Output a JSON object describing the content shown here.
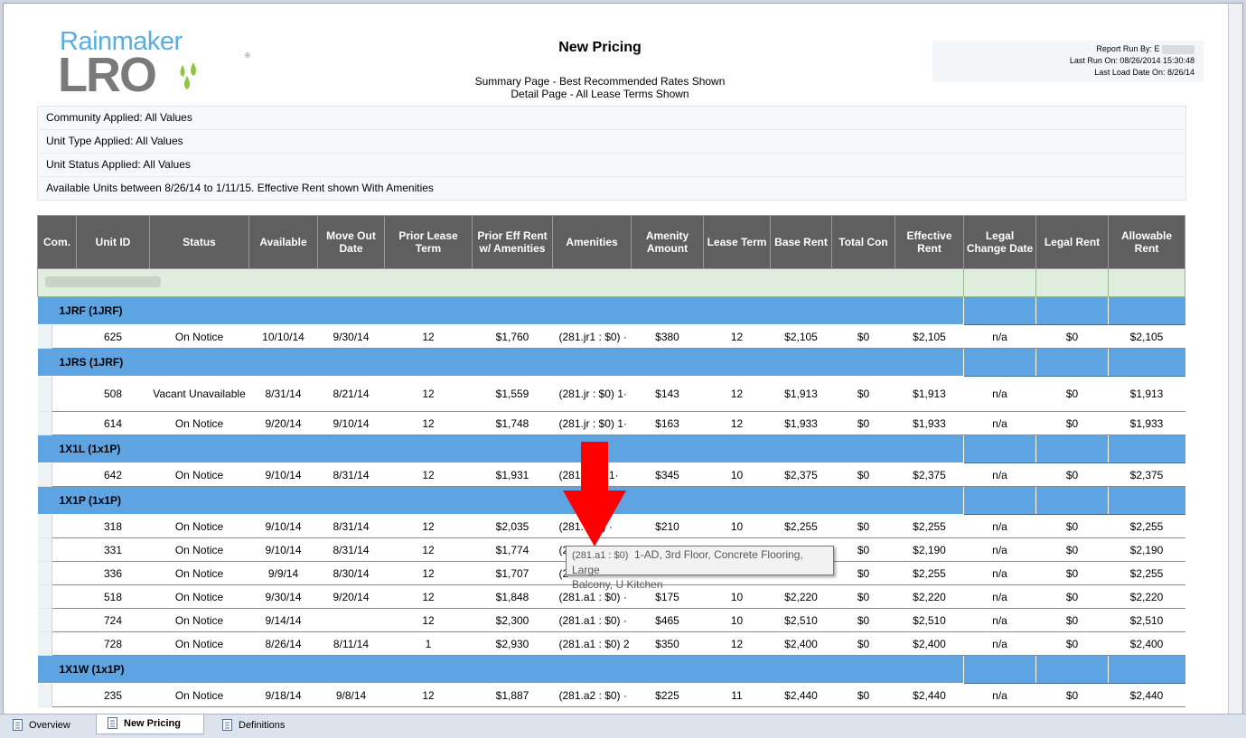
{
  "logo": {
    "rainmaker": "Rainmaker",
    "lro": "LRO",
    "reg": "®"
  },
  "report": {
    "title": "New Pricing",
    "subtitle_1": "Summary Page - Best Recommended Rates Shown",
    "subtitle_2": "Detail Page - All Lease Terms Shown",
    "run_by_label": "Report Run By:",
    "run_by_initial": "E",
    "last_run": "Last Run On: 08/26/2014 15:30:48",
    "last_load": "Last Load Date On: 8/26/14"
  },
  "filters": [
    "Community Applied: All Values",
    "Unit Type Applied: All Values",
    "Unit Status Applied: All Values",
    "Available Units between 8/26/14 to 1/11/15. Effective Rent shown With Amenities"
  ],
  "columns": [
    "Com.",
    "Unit ID",
    "Status",
    "Available",
    "Move Out Date",
    "Prior Lease Term",
    "Prior Eff Rent w/ Amenities",
    "Amenities",
    "Amenity Amount",
    "Lease Term",
    "Base Rent",
    "Total Con",
    "Effective Rent",
    "Legal Change Date",
    "Legal Rent",
    "Allowable Rent"
  ],
  "groups": [
    {
      "label": "1JRF (1JRF)",
      "rows": [
        [
          "625",
          "On Notice",
          "10/10/14",
          "9/30/14",
          "12",
          "$1,760",
          "(281.jr1 : $0)  ·",
          "$380",
          "12",
          "$2,105",
          "$0",
          "$2,105",
          "n/a",
          "$0",
          "$2,105"
        ]
      ]
    },
    {
      "label": "1JRS (1JRF)",
      "rows": [
        [
          "508",
          "Vacant Unavailable",
          "8/31/14",
          "8/21/14",
          "12",
          "$1,559",
          "(281.jr : $0)  1·",
          "$143",
          "12",
          "$1,913",
          "$0",
          "$1,913",
          "n/a",
          "$0",
          "$1,913"
        ],
        [
          "614",
          "On Notice",
          "9/20/14",
          "9/10/14",
          "12",
          "$1,748",
          "(281.jr : $0)  1·",
          "$163",
          "12",
          "$1,933",
          "$0",
          "$1,933",
          "n/a",
          "$0",
          "$1,933"
        ]
      ]
    },
    {
      "label": "1X1L (1x1P)",
      "rows": [
        [
          "642",
          "On Notice",
          "9/10/14",
          "8/31/14",
          "12",
          "$1,931",
          "(281.·   $0)  1·",
          "$345",
          "10",
          "$2,375",
          "$0",
          "$2,375",
          "n/a",
          "$0",
          "$2,375"
        ]
      ]
    },
    {
      "label": "1X1P (1x1P)",
      "rows": [
        [
          "318",
          "On Notice",
          "9/10/14",
          "8/31/14",
          "12",
          "$2,035",
          "(281.·   $0)  ·",
          "$210",
          "10",
          "$2,255",
          "$0",
          "$2,255",
          "n/a",
          "$0",
          "$2,255"
        ],
        [
          "331",
          "On Notice",
          "9/10/14",
          "8/31/14",
          "12",
          "$1,774",
          "(2·",
          "",
          "",
          "",
          "$0",
          "$2,190",
          "n/a",
          "$0",
          "$2,190"
        ],
        [
          "336",
          "On Notice",
          "9/9/14",
          "8/30/14",
          "12",
          "$1,707",
          "(2·",
          "",
          "",
          "",
          "$0",
          "$2,255",
          "n/a",
          "$0",
          "$2,255"
        ],
        [
          "518",
          "On Notice",
          "9/30/14",
          "9/20/14",
          "12",
          "$1,848",
          "(281.a1 : $0)  ·",
          "$175",
          "10",
          "$2,220",
          "$0",
          "$2,220",
          "n/a",
          "$0",
          "$2,220"
        ],
        [
          "724",
          "On Notice",
          "9/14/14",
          "",
          "12",
          "$2,300",
          "(281.a1 : $0)  ·",
          "$465",
          "10",
          "$2,510",
          "$0",
          "$2,510",
          "n/a",
          "$0",
          "$2,510"
        ],
        [
          "728",
          "On Notice",
          "8/26/14",
          "8/11/14",
          "1",
          "$2,930",
          "(281.a1 : $0)  2",
          "$350",
          "12",
          "$2,400",
          "$0",
          "$2,400",
          "n/a",
          "$0",
          "$2,400"
        ]
      ]
    },
    {
      "label": "1X1W (1x1P)",
      "rows": [
        [
          "235",
          "On Notice",
          "9/18/14",
          "9/8/14",
          "12",
          "$1,887",
          "(281.a2 : $0)  ·",
          "$225",
          "11",
          "$2,440",
          "$0",
          "$2,440",
          "n/a",
          "$0",
          "$2,440"
        ]
      ]
    }
  ],
  "tooltip": {
    "code": "(281.a1 : $0)",
    "text_1": "1-AD, 3rd Floor, Concrete Flooring, Large",
    "text_2": "Balcony, U Kitchen"
  },
  "tabs": [
    "Overview",
    "New Pricing",
    "Definitions"
  ],
  "colors": {
    "group_row": "#5ea3e2",
    "header": "#5f5f5f",
    "arrow": "#ff0000",
    "community_row": "#dfeedd"
  }
}
